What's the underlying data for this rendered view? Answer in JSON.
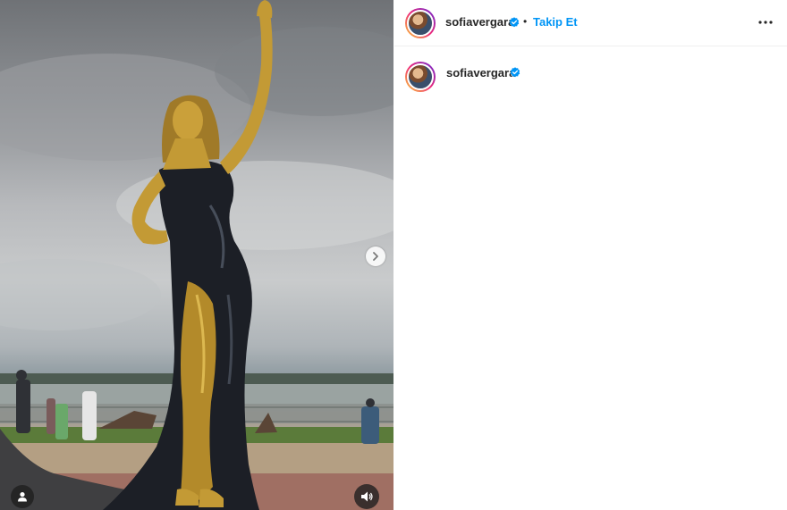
{
  "post": {
    "username": "sofiavergara",
    "verified": true,
    "separator": "•",
    "follow_label": "Takip Et",
    "more_icon": "more-horizontal-icon"
  },
  "caption": {
    "username": "sofiavergara",
    "verified": true
  },
  "media": {
    "next_icon": "chevron-right-icon",
    "tag_icon": "user-tag-icon",
    "sound_icon": "volume-icon"
  },
  "colors": {
    "follow_blue": "#0095f6",
    "verified_blue": "#0095f6",
    "text": "#262626"
  }
}
